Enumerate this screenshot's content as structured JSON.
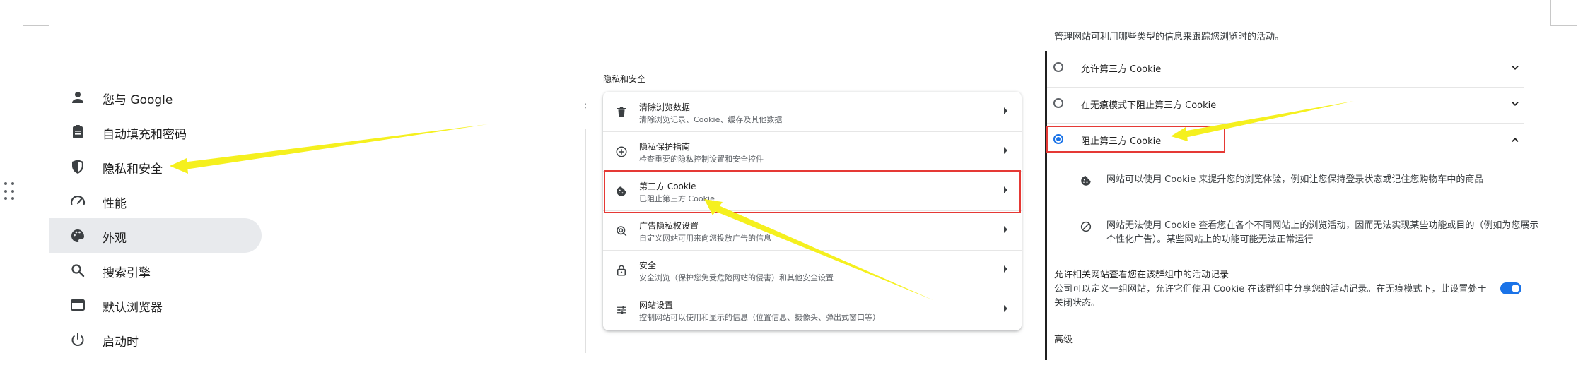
{
  "sidebar": {
    "items": [
      {
        "label": "您与 Google",
        "icon": "person-icon"
      },
      {
        "label": "自动填充和密码",
        "icon": "clipboard-icon"
      },
      {
        "label": "隐私和安全",
        "icon": "shield-icon"
      },
      {
        "label": "性能",
        "icon": "speedometer-icon"
      },
      {
        "label": "外观",
        "icon": "palette-icon",
        "selected": true
      },
      {
        "label": "搜索引擎",
        "icon": "search-icon"
      },
      {
        "label": "默认浏览器",
        "icon": "browser-icon"
      },
      {
        "label": "启动时",
        "icon": "power-icon"
      }
    ]
  },
  "privacy": {
    "section_title": "隐私和安全",
    "edge_mark": ";",
    "rows": [
      {
        "title": "清除浏览数据",
        "subtitle": "清除浏览记录、Cookie、缓存及其他数据",
        "icon": "trash-icon"
      },
      {
        "title": "隐私保护指南",
        "subtitle": "检查重要的隐私控制设置和安全控件",
        "icon": "compass-plus-icon"
      },
      {
        "title": "第三方 Cookie",
        "subtitle": "已阻止第三方 Cookie",
        "icon": "cookie-icon"
      },
      {
        "title": "广告隐私权设置",
        "subtitle": "自定义网站可用来向您投放广告的信息",
        "icon": "ad-privacy-icon"
      },
      {
        "title": "安全",
        "subtitle": "安全浏览（保护您免受危险网站的侵害）和其他安全设置",
        "icon": "lock-icon"
      },
      {
        "title": "网站设置",
        "subtitle": "控制网站可以使用和显示的信息（位置信息、摄像头、弹出式窗口等）",
        "icon": "sliders-icon"
      }
    ]
  },
  "cookies": {
    "description": "管理网站可利用哪些类型的信息来跟踪您浏览时的活动。",
    "options": [
      {
        "label": "允许第三方 Cookie",
        "selected": false
      },
      {
        "label": "在无痕模式下阻止第三方 Cookie",
        "selected": false
      },
      {
        "label": "阻止第三方 Cookie",
        "selected": true
      }
    ],
    "info": [
      {
        "text": "网站可以使用 Cookie 来提升您的浏览体验，例如让您保持登录状态或记住您购物车中的商品",
        "icon": "cookie-icon"
      },
      {
        "text": "网站无法使用 Cookie 查看您在各个不同网站上的浏览活动，因而无法实现某些功能或目的（例如为您展示个性化广告）。某些网站上的功能可能无法正常运行",
        "icon": "block-icon"
      }
    ],
    "related_title": "允许相关网站查看您在该群组中的活动记录",
    "related_desc": "公司可以定义一组网站，允许它们使用 Cookie 在该群组中分享您的活动记录。在无痕模式下，此设置处于关闭状态。",
    "related_enabled": true,
    "advanced": "高级"
  },
  "colors": {
    "accent": "#1a73e8",
    "highlight_box": "#e53935",
    "arrow": "#f5f01e",
    "selected_bg": "#e8eaed"
  }
}
